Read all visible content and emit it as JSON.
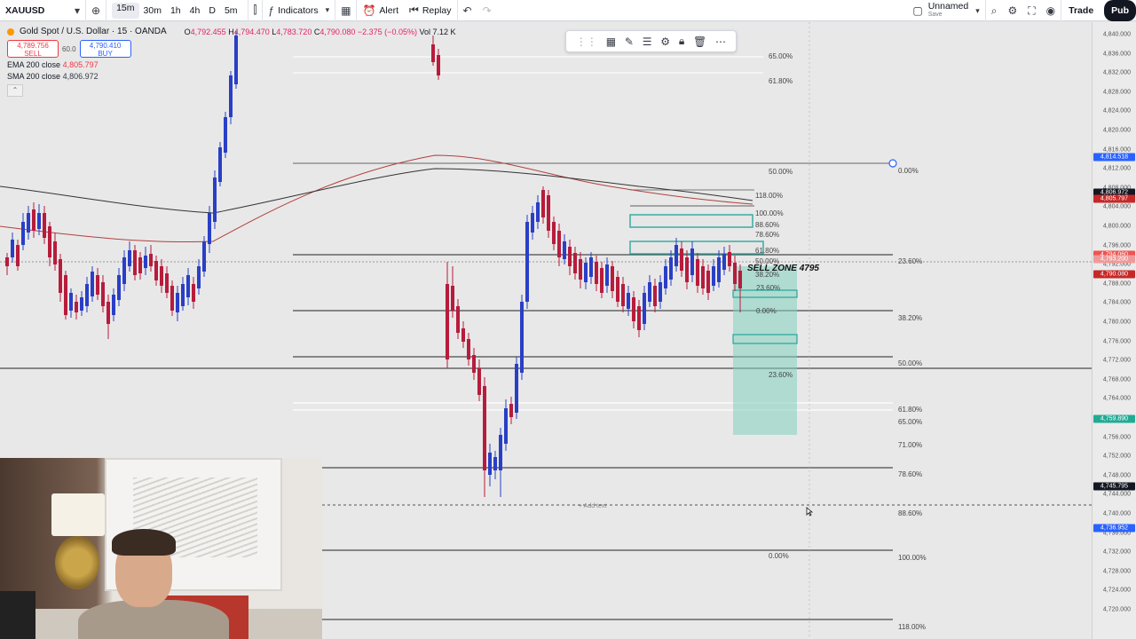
{
  "toolbar": {
    "symbol": "XAUUSD",
    "intervals": [
      {
        "label": "15m",
        "active": true
      },
      {
        "label": "30m",
        "active": false
      },
      {
        "label": "1h",
        "active": false
      },
      {
        "label": "4h",
        "active": false
      },
      {
        "label": "D",
        "active": false
      },
      {
        "label": "5m",
        "active": false
      }
    ],
    "indicators_label": "Indicators",
    "alert_label": "Alert",
    "replay_label": "Replay",
    "layout_name": "Unnamed",
    "layout_sub": "Save",
    "trade_label": "Trade",
    "publish_label": "Pub"
  },
  "legend": {
    "title": "Gold Spot / U.S. Dollar · 15 · OANDA",
    "ohlc": {
      "o_label": "O",
      "o": "4,792.455",
      "h_label": "H",
      "h": "4,794.470",
      "l_label": "L",
      "l": "4,783.720",
      "c_label": "C",
      "c": "4,790.080",
      "change": "−2.375 (−0.05%)",
      "vol_label": "Vol",
      "vol": "7.12 K"
    },
    "sell_price": "4,789.756",
    "sell_label": "SELL",
    "spread": "60.0",
    "buy_price": "4,790.410",
    "buy_label": "BUY",
    "indicators": [
      {
        "name": "EMA 200 close",
        "value": "4,805.797"
      },
      {
        "name": "SMA 200 close",
        "value": "4,806.972"
      }
    ]
  },
  "drawings": {
    "sell_zone_label": "SELL ZONE 4795",
    "add_text_label": "+ Add text",
    "fib_left": [
      "65.00%",
      "61.80%",
      "50.00%",
      "118.00%",
      "100.00%",
      "88.60%",
      "78.60%",
      "61.80%",
      "50.00%",
      "38.20%",
      "23.60%",
      "0.00%",
      "23.60%",
      "0.00%"
    ],
    "fib_right": [
      "0.00%",
      "23.60%",
      "38.20%",
      "50.00%",
      "61.80%",
      "65.00%",
      "71.00%",
      "78.60%",
      "88.60%",
      "100.00%",
      "118.00%"
    ]
  },
  "price_axis": {
    "ticks": [
      "4,840.000",
      "4,836.000",
      "4,832.000",
      "4,828.000",
      "4,824.000",
      "4,820.000",
      "4,816.000",
      "4,812.000",
      "4,808.000",
      "4,804.000",
      "4,800.000",
      "4,796.000",
      "4,792.000",
      "4,788.000",
      "4,784.000",
      "4,780.000",
      "4,776.000",
      "4,772.000",
      "4,768.000",
      "4,764.000",
      "4,760.000",
      "4,756.000",
      "4,752.000",
      "4,748.000",
      "4,744.000",
      "4,740.000",
      "4,736.000",
      "4,732.000",
      "4,728.000",
      "4,724.000",
      "4,720.000"
    ],
    "tags": [
      {
        "value": "4,814.518",
        "color": "#2962ff"
      },
      {
        "value": "4,806.972",
        "color": "#131722"
      },
      {
        "value": "4,805.797",
        "color": "#c62828"
      },
      {
        "value": "4,794.060",
        "color": "#ef5350"
      },
      {
        "value": "4,793.200",
        "color": "#ef9a9a"
      },
      {
        "value": "4,790.080",
        "color": "#c62828"
      },
      {
        "value": "4,759.890",
        "color": "#22ab94"
      },
      {
        "value": "4,745.795",
        "color": "#131722"
      },
      {
        "value": "4,736.952",
        "color": "#2962ff"
      }
    ]
  },
  "colors": {
    "up_candle": "#2a3fc6",
    "down_candle": "#b71c3c",
    "sell_zone": "#7fd0bd",
    "ema": "#b0413e",
    "sma": "#333333"
  }
}
